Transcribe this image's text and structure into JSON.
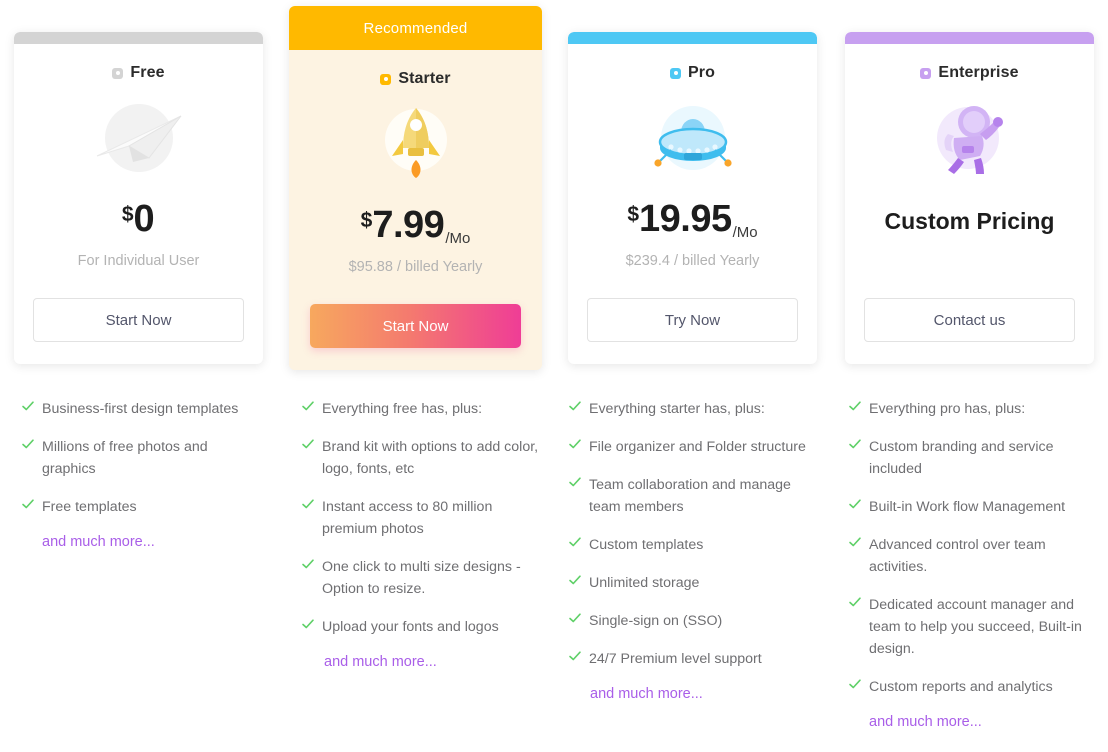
{
  "theme": {
    "free_accent": "#d4d4d4",
    "starter_accent": "#ffb900",
    "pro_accent": "#4ec8f4",
    "enterprise_accent": "#c7a0f0",
    "tick_color": "#5fd068",
    "more_link_color": "#a95ee8",
    "featured_bg": "#fdf3e2",
    "cta_gradient_from": "#f7a85e",
    "cta_gradient_to": "#ef3d96"
  },
  "plans": [
    {
      "id": "free",
      "ribbon": "",
      "name": "Free",
      "icon": "paper-plane-illustration",
      "currency": "$",
      "amount": "0",
      "per": "",
      "sub": "For Individual User",
      "custom_price": "",
      "cta": "Start Now",
      "cta_style": "outline",
      "features": [
        "Business-first design templates",
        "Millions of free photos and graphics",
        "Free templates"
      ],
      "more": "and much more..."
    },
    {
      "id": "starter",
      "ribbon": "Recommended",
      "name": "Starter",
      "icon": "rocket-illustration",
      "currency": "$",
      "amount": "7.99",
      "per": "/Mo",
      "sub": "$95.88 / billed Yearly",
      "custom_price": "",
      "cta": "Start Now",
      "cta_style": "filled",
      "features": [
        "Everything free has, plus:",
        "Brand kit with options to add color, logo, fonts, etc",
        "Instant access to 80 million premium photos",
        "One click to multi size designs - Option to resize.",
        "Upload your fonts and logos"
      ],
      "more": "and much more..."
    },
    {
      "id": "pro",
      "ribbon": "",
      "name": "Pro",
      "icon": "ufo-illustration",
      "currency": "$",
      "amount": "19.95",
      "per": "/Mo",
      "sub": "$239.4 / billed Yearly",
      "custom_price": "",
      "cta": "Try Now",
      "cta_style": "outline",
      "features": [
        "Everything starter has, plus:",
        "File organizer and Folder structure",
        "Team collaboration and manage team members",
        "Custom templates",
        "Unlimited storage",
        "Single-sign on (SSO)",
        "24/7 Premium level support"
      ],
      "more": "and much more..."
    },
    {
      "id": "enterprise",
      "ribbon": "",
      "name": "Enterprise",
      "icon": "astronaut-illustration",
      "currency": "",
      "amount": "",
      "per": "",
      "sub": "",
      "custom_price": "Custom Pricing",
      "cta": "Contact us",
      "cta_style": "outline",
      "features": [
        "Everything pro has, plus:",
        "Custom branding and service included",
        "Built-in Work flow Management",
        "Advanced control over team activities.",
        "Dedicated account manager and team to help you succeed, Built-in design.",
        "Custom reports and analytics"
      ],
      "more": "and much more..."
    }
  ]
}
